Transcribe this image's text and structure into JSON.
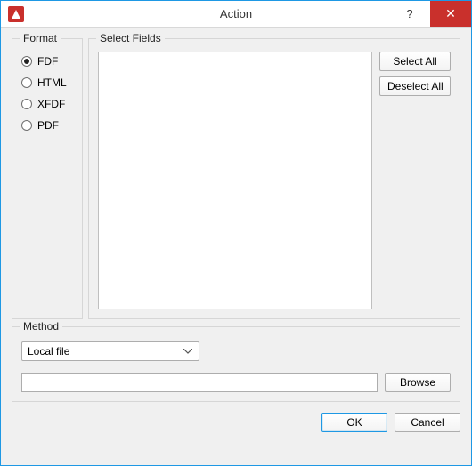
{
  "window": {
    "title": "Action"
  },
  "format": {
    "legend": "Format",
    "options": {
      "fdf": "FDF",
      "html": "HTML",
      "xfdf": "XFDF",
      "pdf": "PDF"
    },
    "selected": "fdf"
  },
  "fields": {
    "legend": "Select Fields",
    "select_all": "Select All",
    "deselect_all": "Deselect All"
  },
  "method": {
    "legend": "Method",
    "selected": "Local file",
    "path": "",
    "browse": "Browse"
  },
  "footer": {
    "ok": "OK",
    "cancel": "Cancel"
  }
}
